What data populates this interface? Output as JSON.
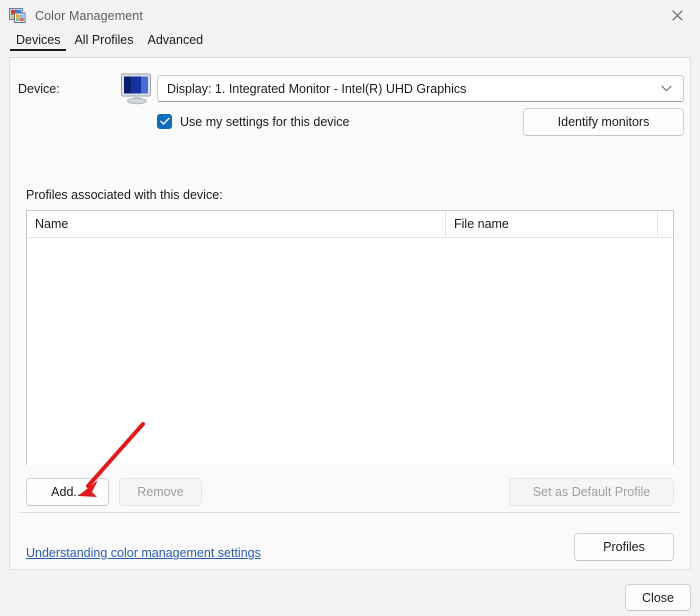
{
  "window": {
    "title": "Color Management",
    "icon": "color-management-icon",
    "close_icon": "close-icon"
  },
  "tabs": [
    {
      "label": "Devices",
      "active": true
    },
    {
      "label": "All Profiles",
      "active": false
    },
    {
      "label": "Advanced",
      "active": false
    }
  ],
  "device_section": {
    "label": "Device:",
    "icon": "monitor-icon",
    "dropdown": {
      "value": "Display: 1. Integrated Monitor - Intel(R) UHD Graphics",
      "arrow_icon": "chevron-down-icon"
    },
    "checkbox": {
      "label": "Use my settings for this device",
      "checked": true
    },
    "identify_button": "Identify monitors"
  },
  "profiles_section": {
    "caption": "Profiles associated with this device:",
    "columns": [
      "Name",
      "File name"
    ],
    "rows": [],
    "buttons": {
      "add": "Add...",
      "remove": "Remove",
      "set_default": "Set as Default Profile"
    }
  },
  "footer": {
    "help_link": "Understanding color management settings",
    "profiles_button": "Profiles",
    "close_button": "Close"
  },
  "annotation": {
    "type": "red-arrow",
    "color": "#e01b1b",
    "points_to": "Add..."
  }
}
